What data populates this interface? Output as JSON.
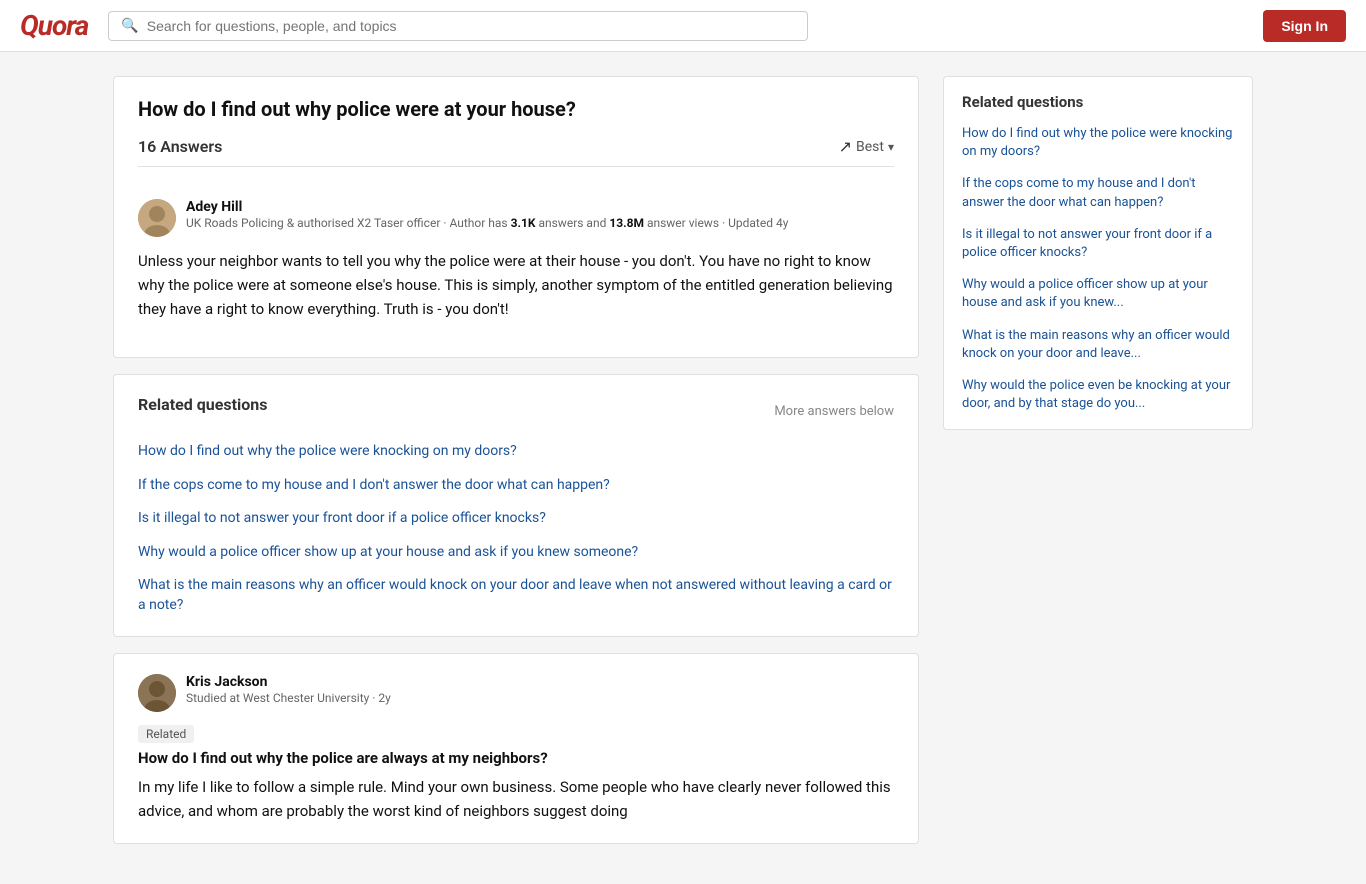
{
  "header": {
    "logo": "Quora",
    "search_placeholder": "Search for questions, people, and topics",
    "sign_in_label": "Sign In"
  },
  "main_question": {
    "title": "How do I find out why police were at your house?"
  },
  "answers_header": {
    "count_label": "16 Answers",
    "sort_label": "Best"
  },
  "first_answer": {
    "author_name": "Adey Hill",
    "author_meta_prefix": "UK Roads Policing & authorised X2 Taser officer · Author has ",
    "author_answers": "3.1K",
    "author_meta_mid": " answers and ",
    "author_views": "13.8M",
    "author_meta_suffix": " answer views · Updated 4y",
    "text": "Unless your neighbor wants to tell you why the police were at their house - you don't. You have no right to know why the police were at someone else's house. This is simply, another symptom of the entitled generation believing they have a right to know everything. Truth is - you don't!"
  },
  "related_questions_inline": {
    "title": "Related questions",
    "more_label": "More answers below",
    "links": [
      "How do I find out why the police were knocking on my doors?",
      "If the cops come to my house and I don't answer the door what can happen?",
      "Is it illegal to not answer your front door if a police officer knocks?",
      "Why would a police officer show up at your house and ask if you knew someone?",
      "What is the main reasons why an officer would knock on your door and leave when not answered without leaving a card or a note?"
    ]
  },
  "second_answer": {
    "author_name": "Kris Jackson",
    "author_meta": "Studied at West Chester University · 2y",
    "related_badge": "Related",
    "related_question": "How do I find out why the police are always at my neighbors?",
    "text": "In my life I like to follow a simple rule. Mind your own business. Some people who have clearly never followed this advice, and whom are probably the worst kind of neighbors suggest doing"
  },
  "sidebar": {
    "title": "Related questions",
    "links": [
      "How do I find out why the police were knocking on my doors?",
      "If the cops come to my house and I don't answer the door what can happen?",
      "Is it illegal to not answer your front door if a police officer knocks?",
      "Why would a police officer show up at your house and ask if you knew...",
      "What is the main reasons why an officer would knock on your door and leave...",
      "Why would the police even be knocking at your door, and by that stage do you..."
    ]
  }
}
